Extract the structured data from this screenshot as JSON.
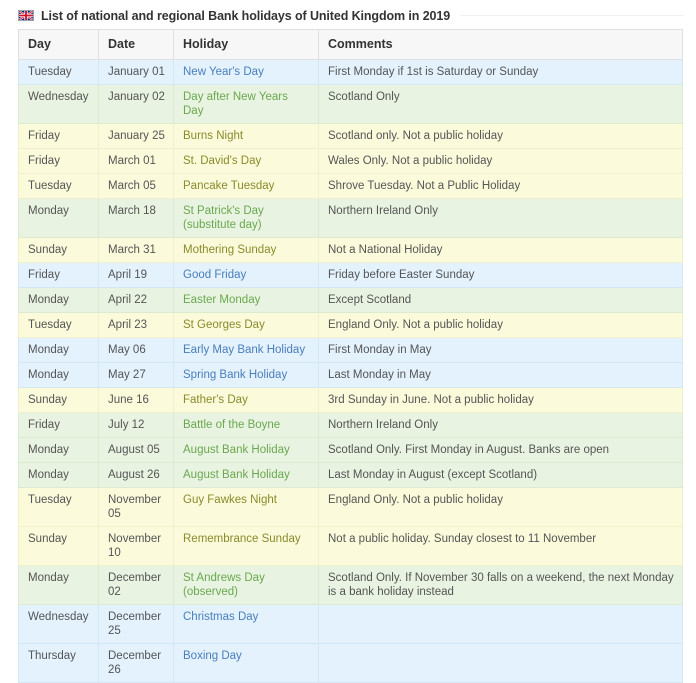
{
  "header": {
    "flag_icon": "union-jack-flag-icon",
    "title": "List of national and regional Bank holidays of United Kingdom in 2019"
  },
  "table": {
    "columns": [
      "Day",
      "Date",
      "Holiday",
      "Comments"
    ],
    "tints": {
      "blue": "#e3f2fd",
      "green": "#e9f3e1",
      "yellow": "#fbfbdc",
      "blue_text": "#4a7ebb",
      "green_text": "#6aa84f",
      "yellow_text": "#8a8a2b",
      "header_bg": "#f7f7f7"
    },
    "rows": [
      {
        "day": "Tuesday",
        "date": "January 01",
        "holiday": "New Year's Day",
        "comment": "First Monday if 1st is Saturday or Sunday",
        "tint": "blue"
      },
      {
        "day": "Wednesday",
        "date": "January 02",
        "holiday": "Day after New Years Day",
        "comment": "Scotland Only",
        "tint": "green"
      },
      {
        "day": "Friday",
        "date": "January 25",
        "holiday": "Burns Night",
        "comment": "Scotland only. Not a public holiday",
        "tint": "yellow"
      },
      {
        "day": "Friday",
        "date": "March 01",
        "holiday": "St. David's Day",
        "comment": "Wales Only. Not a public holiday",
        "tint": "yellow"
      },
      {
        "day": "Tuesday",
        "date": "March 05",
        "holiday": "Pancake Tuesday",
        "comment": "Shrove Tuesday. Not a Public Holiday",
        "tint": "yellow"
      },
      {
        "day": "Monday",
        "date": "March 18",
        "holiday": "St Patrick's Day (substitute day)",
        "comment": "Northern Ireland Only",
        "tint": "green"
      },
      {
        "day": "Sunday",
        "date": "March 31",
        "holiday": "Mothering Sunday",
        "comment": "Not a National Holiday",
        "tint": "yellow"
      },
      {
        "day": "Friday",
        "date": "April 19",
        "holiday": "Good Friday",
        "comment": "Friday before Easter Sunday",
        "tint": "blue"
      },
      {
        "day": "Monday",
        "date": "April 22",
        "holiday": "Easter Monday",
        "comment": "Except Scotland",
        "tint": "green"
      },
      {
        "day": "Tuesday",
        "date": "April 23",
        "holiday": "St Georges Day",
        "comment": "England Only. Not a public holiday",
        "tint": "yellow"
      },
      {
        "day": "Monday",
        "date": "May 06",
        "holiday": "Early May Bank Holiday",
        "comment": "First Monday in May",
        "tint": "blue"
      },
      {
        "day": "Monday",
        "date": "May 27",
        "holiday": "Spring Bank Holiday",
        "comment": "Last Monday in May",
        "tint": "blue"
      },
      {
        "day": "Sunday",
        "date": "June 16",
        "holiday": "Father's Day",
        "comment": "3rd Sunday in June. Not a public holiday",
        "tint": "yellow"
      },
      {
        "day": "Friday",
        "date": "July 12",
        "holiday": "Battle of the Boyne",
        "comment": "Northern Ireland Only",
        "tint": "green"
      },
      {
        "day": "Monday",
        "date": "August 05",
        "holiday": "August Bank Holiday",
        "comment": "Scotland Only. First Monday in August. Banks are open",
        "tint": "green"
      },
      {
        "day": "Monday",
        "date": "August 26",
        "holiday": "August Bank Holiday",
        "comment": "Last Monday in August (except Scotland)",
        "tint": "green"
      },
      {
        "day": "Tuesday",
        "date": "November 05",
        "holiday": "Guy Fawkes Night",
        "comment": "England Only. Not a public holiday",
        "tint": "yellow"
      },
      {
        "day": "Sunday",
        "date": "November 10",
        "holiday": "Remembrance Sunday",
        "comment": "Not a public holiday. Sunday closest to 11 November",
        "tint": "yellow"
      },
      {
        "day": "Monday",
        "date": "December 02",
        "holiday": "St Andrews Day (observed)",
        "comment": "Scotland Only. If November 30 falls on a weekend, the next Monday is a bank holiday instead",
        "tint": "green"
      },
      {
        "day": "Wednesday",
        "date": "December 25",
        "holiday": "Christmas Day",
        "comment": "",
        "tint": "blue"
      },
      {
        "day": "Thursday",
        "date": "December 26",
        "holiday": "Boxing Day",
        "comment": "",
        "tint": "blue"
      }
    ]
  }
}
